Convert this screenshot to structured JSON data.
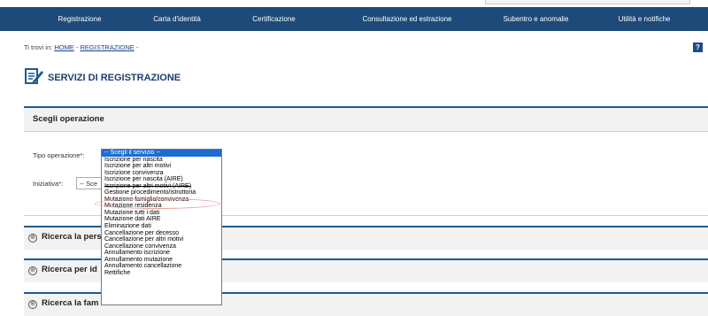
{
  "nav": {
    "items": [
      {
        "label": "Registrazione"
      },
      {
        "label": "Carta d'identità"
      },
      {
        "label": "Certificazione"
      },
      {
        "label": "Consultazione ed estrazione"
      },
      {
        "label": "Subentro e anomalie"
      },
      {
        "label": "Utilità e notifiche"
      }
    ]
  },
  "breadcrumb": {
    "prefix": "Ti trovi in: ",
    "home": "HOME",
    "sep1": " - ",
    "current": "REGISTRAZIONE",
    "sep2": " -"
  },
  "help": {
    "label": "?"
  },
  "page": {
    "title": "SERVIZI DI REGISTRAZIONE"
  },
  "operazione": {
    "header": "Scegli operazione",
    "tipo_label": "Tipo operazione*:",
    "iniziativa_label": "Iniziativa*:",
    "iniziativa_value": "-- Sce"
  },
  "dropdown": {
    "options": [
      "-- Scegli il servizio --",
      "Iscrizione per nascita",
      "Iscrizione per altri motivi",
      "Iscrizione convivenza",
      "Iscrizione per nascita (AIRE)",
      "Iscrizione per altri motivi (AIRE)",
      "Gestione procedimento/istruttoria",
      "Mutazione famiglia/convivenza",
      "Mutazione residenza",
      "Mutazione tutti i dati",
      "Mutazione dati AIRE",
      "Eliminazione dati",
      "Cancellazione per decesso",
      "Cancellazione per altri motivi",
      "Cancellazione convivenza",
      "Annullamento iscrizione",
      "Annullamento mutazione",
      "Annullamento cancellazione",
      "Rettifiche"
    ],
    "selected": "-- Scegli il servizio --"
  },
  "sections": [
    {
      "label": "Ricerca la pers"
    },
    {
      "label": "Ricerca per id"
    },
    {
      "label": "Ricerca la fam"
    }
  ],
  "colors": {
    "navbar": "#1d4a78",
    "accent": "#1e5a8e",
    "selected": "#1e6ccf"
  }
}
